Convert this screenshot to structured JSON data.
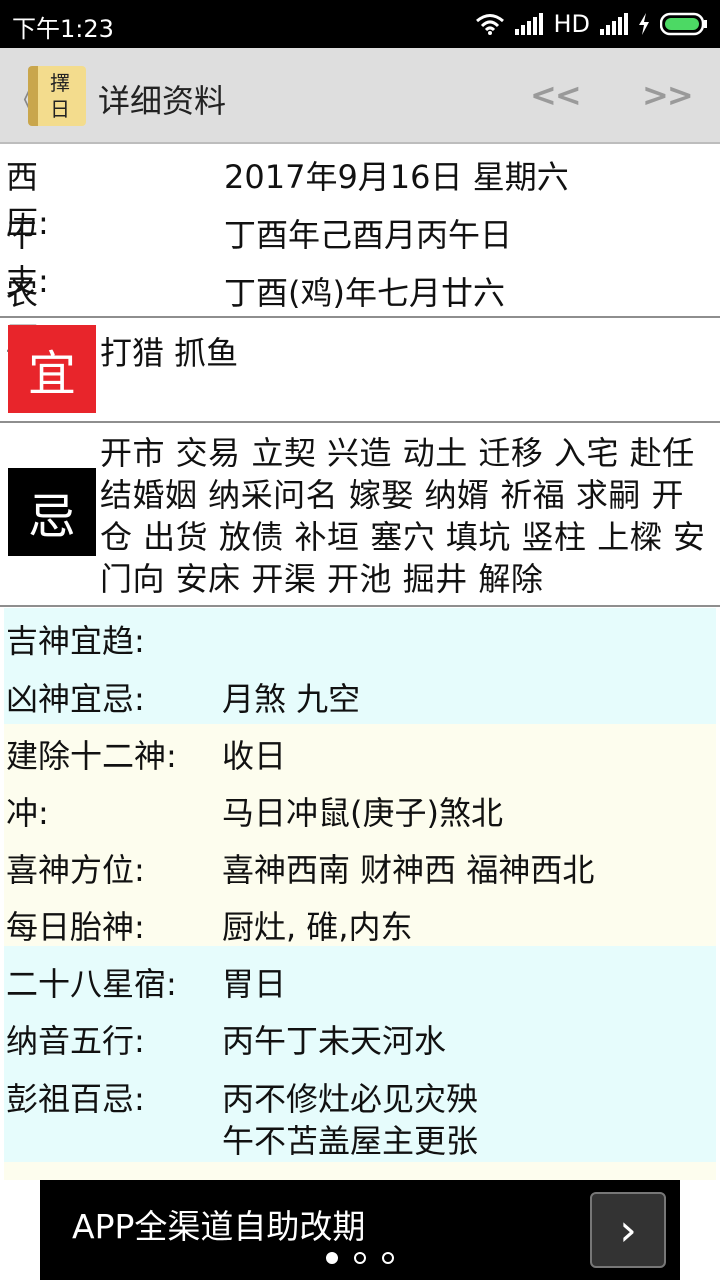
{
  "status": {
    "time": "下午1:23",
    "network": "HD"
  },
  "header": {
    "back": "《",
    "logo_top": "擇",
    "logo_bottom": "日",
    "title": "详细资料",
    "prev": "<<",
    "next": ">>"
  },
  "dates": [
    {
      "label": "西历:",
      "value": "2017年9月16日 星期六"
    },
    {
      "label": "干支:",
      "value": "丁酉年己酉月丙午日"
    },
    {
      "label": "农历:",
      "value": "丁酉(鸡)年七月廿六"
    }
  ],
  "yi": {
    "badge": "宜",
    "text": "打猎 抓鱼"
  },
  "ji": {
    "badge": "忌",
    "text": "开市 交易 立契 兴造 动土 迁移 入宅 赴任 结婚姻 纳采问名 嫁娶 纳婿 祈福 求嗣 开仓 出货 放债 补垣 塞穴 填坑 竖柱 上樑 安门向 安床 开渠 开池 掘井 解除"
  },
  "info": [
    {
      "label": "吉神宜趋:",
      "value": ""
    },
    {
      "label": "凶神宜忌:",
      "value": "月煞 九空"
    },
    {
      "label": "建除十二神:",
      "value": "收日"
    },
    {
      "label": "冲:",
      "value": "马日冲鼠(庚子)煞北"
    },
    {
      "label": "喜神方位:",
      "value": "喜神西南 财神西 福神西北"
    },
    {
      "label": "每日胎神:",
      "value": "厨灶, 碓,内东"
    },
    {
      "label": "二十八星宿:",
      "value": "胃日"
    },
    {
      "label": "纳音五行:",
      "value": "丙午丁未天河水"
    },
    {
      "label": "彭祖百忌:",
      "value": "丙不修灶必见灾殃",
      "value2": "午不苫盖屋主更张"
    }
  ],
  "ad": {
    "text": "APP全渠道自助改期",
    "arrow": "›"
  },
  "colors": {
    "yi": "#e8252b",
    "ji": "#000000",
    "blue_bg": "#e6fcfc",
    "cream_bg": "#fdfdee"
  }
}
